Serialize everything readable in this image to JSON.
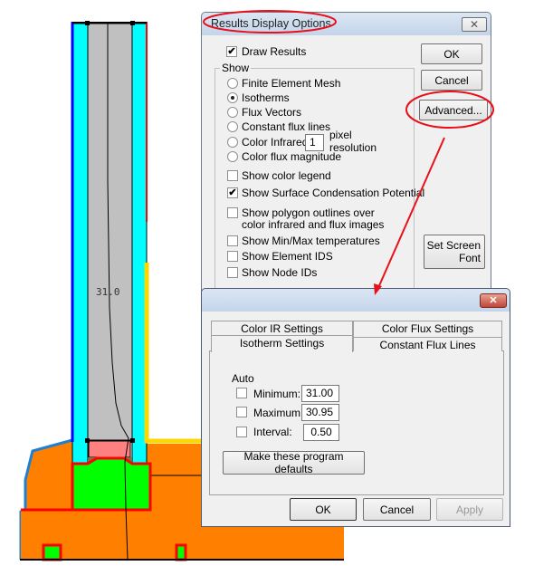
{
  "drawing": {
    "isotherm_label": "31.0",
    "colors": {
      "glass": "#00ffff",
      "gap": "#c0c0c0",
      "frame": "#ff8000",
      "spacer": "#00ff00",
      "seal": "#ff8080",
      "boundary_hot": "#ff0000",
      "boundary_cold": "#0000ff",
      "condensation": "#ffd700"
    }
  },
  "results_dialog": {
    "title": "Results Display Options",
    "close_icon": "close-x-icon",
    "draw_results": {
      "label": "Draw Results",
      "checked": true
    },
    "show_group_label": "Show",
    "radios": [
      {
        "label": "Finite Element Mesh",
        "selected": false
      },
      {
        "label": "Isotherms",
        "selected": true
      },
      {
        "label": "Flux Vectors",
        "selected": false
      },
      {
        "label": "Constant flux lines",
        "selected": false
      },
      {
        "label": "Color Infrared",
        "selected": false
      },
      {
        "label": "Color flux magnitude",
        "selected": false
      }
    ],
    "pixel_resolution_value": "1",
    "pixel_label": "pixel",
    "resolution_label": "resolution",
    "checkboxes": [
      {
        "label": "Show color legend",
        "checked": false
      },
      {
        "label": "Show Surface Condensation Potential",
        "checked": true
      },
      {
        "label": "Show polygon outlines over",
        "label2": "color infrared and flux images",
        "checked": false
      },
      {
        "label": "Show Min/Max temperatures",
        "checked": false
      },
      {
        "label": "Show Element IDS",
        "checked": false
      },
      {
        "label": "Show Node IDs",
        "checked": false
      }
    ],
    "ok": "OK",
    "cancel": "Cancel",
    "advanced": "Advanced...",
    "set_screen_font_1": "Set Screen",
    "set_screen_font_2": "Font"
  },
  "advanced_dialog": {
    "tabs": [
      "Color IR Settings",
      "Color Flux Settings",
      "Isotherm Settings",
      "Constant Flux Lines"
    ],
    "active_tab": "Isotherm Settings",
    "auto_label": "Auto",
    "fields": [
      {
        "label": "Minimum:",
        "value": "31.00",
        "auto": false
      },
      {
        "label": "Maximum:",
        "value": "30.95",
        "auto": false
      },
      {
        "label": "Interval:",
        "value": "0.50",
        "auto": false
      }
    ],
    "make_defaults": "Make these program defaults",
    "ok": "OK",
    "cancel": "Cancel",
    "apply": "Apply",
    "annotation_color": "#e8101a"
  }
}
